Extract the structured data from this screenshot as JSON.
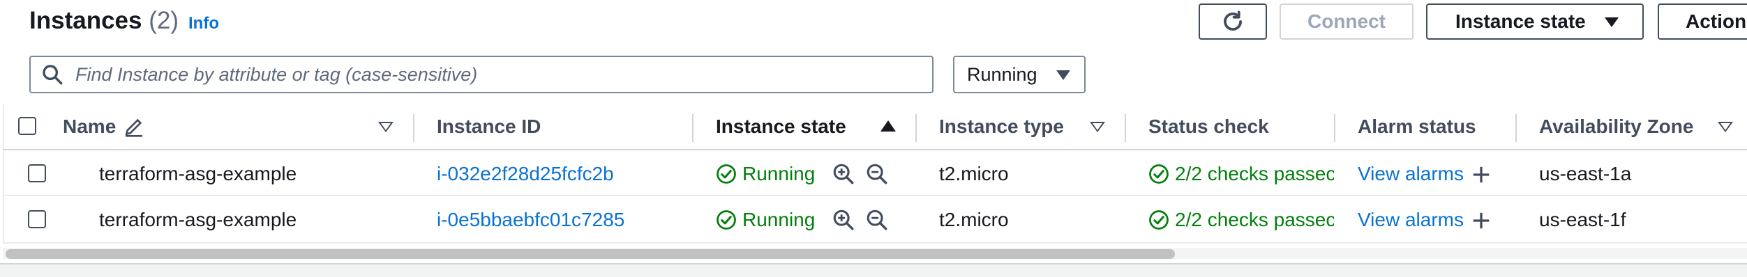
{
  "header": {
    "title": "Instances",
    "count": "(2)",
    "info_link": "Info"
  },
  "toolbar": {
    "refresh_icon": "refresh-icon",
    "connect_label": "Connect",
    "instance_state_label": "Instance state",
    "actions_label": "Action"
  },
  "search": {
    "placeholder": "Find Instance by attribute or tag (case-sensitive)",
    "value": ""
  },
  "filter": {
    "selected": "Running"
  },
  "table": {
    "columns": {
      "name": "Name",
      "instance_id": "Instance ID",
      "instance_state": "Instance state",
      "instance_type": "Instance type",
      "status_check": "Status check",
      "alarm_status": "Alarm status",
      "availability_zone": "Availability Zone"
    },
    "rows": [
      {
        "name": "terraform-asg-example",
        "instance_id": "i-032e2f28d25fcfc2b",
        "state": "Running",
        "type": "t2.micro",
        "status_check": "2/2 checks passec",
        "alarm_link": "View alarms",
        "zone": "us-east-1a"
      },
      {
        "name": "terraform-asg-example",
        "instance_id": "i-0e5bbaebfc01c7285",
        "state": "Running",
        "type": "t2.micro",
        "status_check": "2/2 checks passec",
        "alarm_link": "View alarms",
        "zone": "us-east-1f"
      }
    ]
  },
  "colors": {
    "link": "#0972d3",
    "success": "#037f0c",
    "text": "#16191f",
    "border": "#414d5c"
  }
}
